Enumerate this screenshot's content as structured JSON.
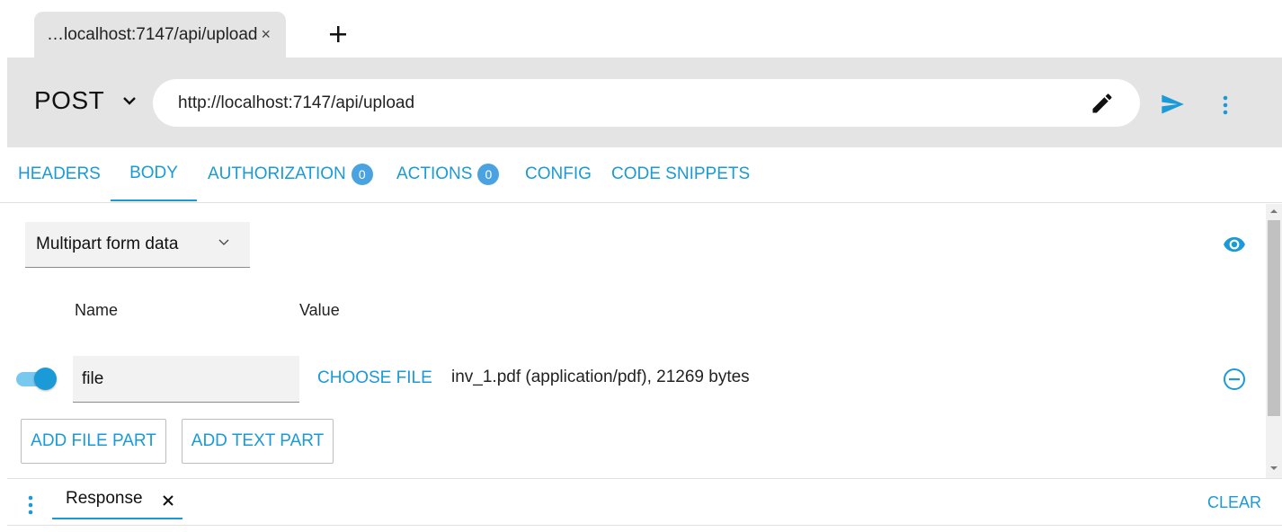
{
  "tab": {
    "title": "…localhost:7147/api/upload",
    "close": "×"
  },
  "request": {
    "method": "POST",
    "url": "http://localhost:7147/api/upload"
  },
  "request_tabs": [
    {
      "label": "HEADERS"
    },
    {
      "label": "BODY",
      "active": true
    },
    {
      "label": "AUTHORIZATION",
      "badge": "0"
    },
    {
      "label": "ACTIONS",
      "badge": "0"
    },
    {
      "label": "CONFIG"
    },
    {
      "label": "CODE SNIPPETS"
    }
  ],
  "body": {
    "type": "Multipart form data",
    "columns": {
      "name": "Name",
      "value": "Value"
    },
    "parts": [
      {
        "enabled": true,
        "name": "file",
        "choose_label": "CHOOSE FILE",
        "file_info": "inv_1.pdf (application/pdf), 21269 bytes"
      }
    ],
    "add_file_label": "ADD FILE PART",
    "add_text_label": "ADD TEXT PART"
  },
  "response": {
    "tab_label": "Response",
    "clear_label": "CLEAR"
  },
  "colors": {
    "accent": "#1a9ad6",
    "bar_bg": "#e4e4e4",
    "badge": "#4aa3e0"
  }
}
